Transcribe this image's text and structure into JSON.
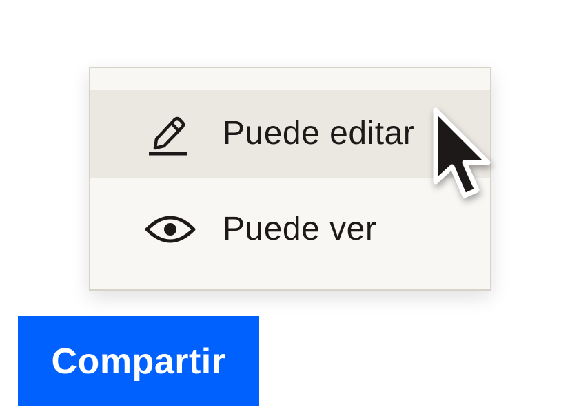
{
  "menu": {
    "items": [
      {
        "label": "Puede editar",
        "icon": "pencil-icon",
        "highlighted": true
      },
      {
        "label": "Puede ver",
        "icon": "eye-icon",
        "highlighted": false
      }
    ]
  },
  "share_button": {
    "label": "Compartir"
  },
  "colors": {
    "button_bg": "#0061fe",
    "menu_bg": "#f8f7f4",
    "menu_hover": "#ebe7e1",
    "text": "#1e1919"
  }
}
